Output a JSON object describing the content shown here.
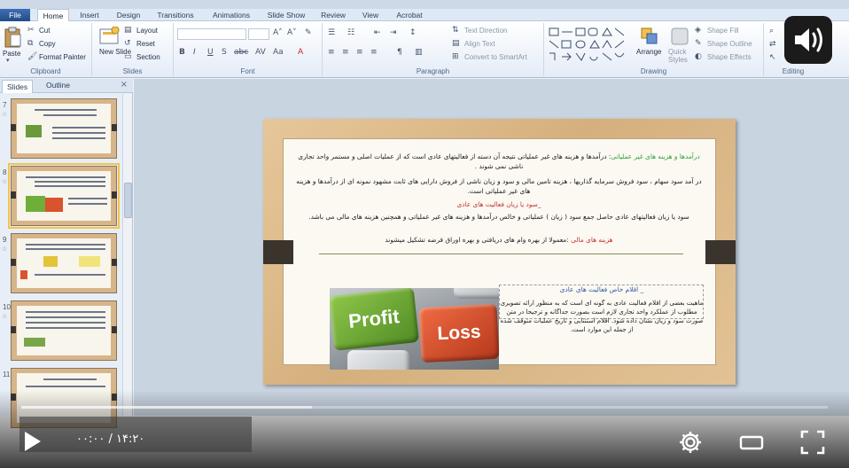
{
  "ribbon": {
    "tabs": [
      {
        "label": "File"
      },
      {
        "label": "Home"
      },
      {
        "label": "Insert"
      },
      {
        "label": "Design"
      },
      {
        "label": "Transitions"
      },
      {
        "label": "Animations"
      },
      {
        "label": "Slide Show"
      },
      {
        "label": "Review"
      },
      {
        "label": "View"
      },
      {
        "label": "Acrobat"
      }
    ],
    "clipboard": {
      "paste": "Paste",
      "cut": "Cut",
      "copy": "Copy",
      "format_painter": "Format Painter",
      "label": "Clipboard"
    },
    "slides": {
      "new_slide": "New Slide",
      "layout": "Layout",
      "reset": "Reset",
      "section": "Section",
      "label": "Slides"
    },
    "font": {
      "label": "Font"
    },
    "paragraph": {
      "text_direction": "Text Direction",
      "align_text": "Align Text",
      "convert_smartart": "Convert to SmartArt",
      "label": "Paragraph"
    },
    "drawing": {
      "arrange": "Arrange",
      "quick_styles": "Quick Styles",
      "shape_fill": "Shape Fill",
      "shape_outline": "Shape Outline",
      "shape_effects": "Shape Effects",
      "label": "Drawing"
    },
    "editing": {
      "label": "Editing"
    }
  },
  "slides_panel": {
    "tab_slides": "Slides",
    "tab_outline": "Outline",
    "close": "×",
    "thumbnails": [
      {
        "number": "7"
      },
      {
        "number": "8",
        "selected": true
      },
      {
        "number": "9"
      },
      {
        "number": "10"
      },
      {
        "number": "11"
      }
    ]
  },
  "slide": {
    "p1_highlight": "درآمدها و هزینه های غیر عملیاتی",
    "p1_rest": ": درآمدها و هزینه های غیر عملیاتی نتیجه آن دسته از فعالیتهای عادی است که از عملیات اصلی و مستمر واحد تجاری ناشی نمی شوند .",
    "p2": "در آمد سود سهام ، سود فروش سرمایه گذاریها ، هزینه تامین مالی و سود و زیان ناشی از فروش دارایی های ثابت مشهود نمونه ای از درآمدها و هزینه های غیر عملیاتی است.",
    "h2": "_سود یا زیان فعالیت های عادی",
    "p3": "سود یا زیان فعالیتهای عادی حاصل جمع سود ( زیان ) عملیاتی و خالص درآمدها و هزینه های غیر عملیاتی و همچنین هزینه های مالی می باشد.",
    "p4_highlight": "هزینه های مالی",
    "p4_rest": " :معمولا از بهره وام های دریافتی و بهره اوراق قرضه تشکیل میشوند",
    "h3": "_ اقلام خاص فعالیت های عادی",
    "p5": "ماهیت بعضی از اقلام فعالیت عادی به گونه ای است که به منظور ارائه تصویری مطلوب از عملکرد واحد تجاری لازم است بصورت جداگانه و ترجیحا در متن صورت سود و زیان نشان داده شود. اقلام استثنایی و تاریخ عملیات متوقف شده از جمله این موارد است.",
    "image_key_profit": "Profit",
    "image_key_loss": "Loss"
  },
  "player": {
    "time_current": "۰۰:۰۰",
    "time_separator": "/",
    "time_total": "۱۴:۲۰",
    "progress": 0.0,
    "buffered_fraction": 0.36
  }
}
